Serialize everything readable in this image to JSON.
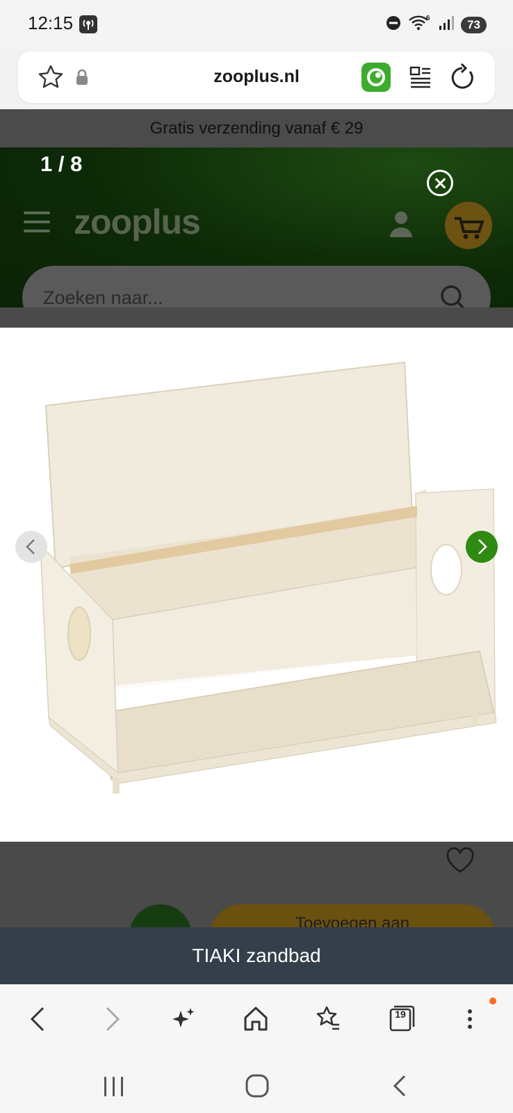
{
  "status_bar": {
    "time": "12:15",
    "battery": "73",
    "signal_label": "6"
  },
  "browser": {
    "url": "zooplus.nl",
    "tab_count": "19"
  },
  "site": {
    "promo": "Gratis verzending vanaf € 29",
    "logo": "zooplus",
    "search_placeholder": "Zoeken naar...",
    "add_to_cart_label": "Toevoegen aan"
  },
  "gallery": {
    "counter": "1 / 8",
    "caption": "TIAKI zandbad"
  },
  "colors": {
    "accent_green": "#2f8a12",
    "caption_bg": "#343f4b",
    "notification_dot": "#ff6b1a"
  }
}
